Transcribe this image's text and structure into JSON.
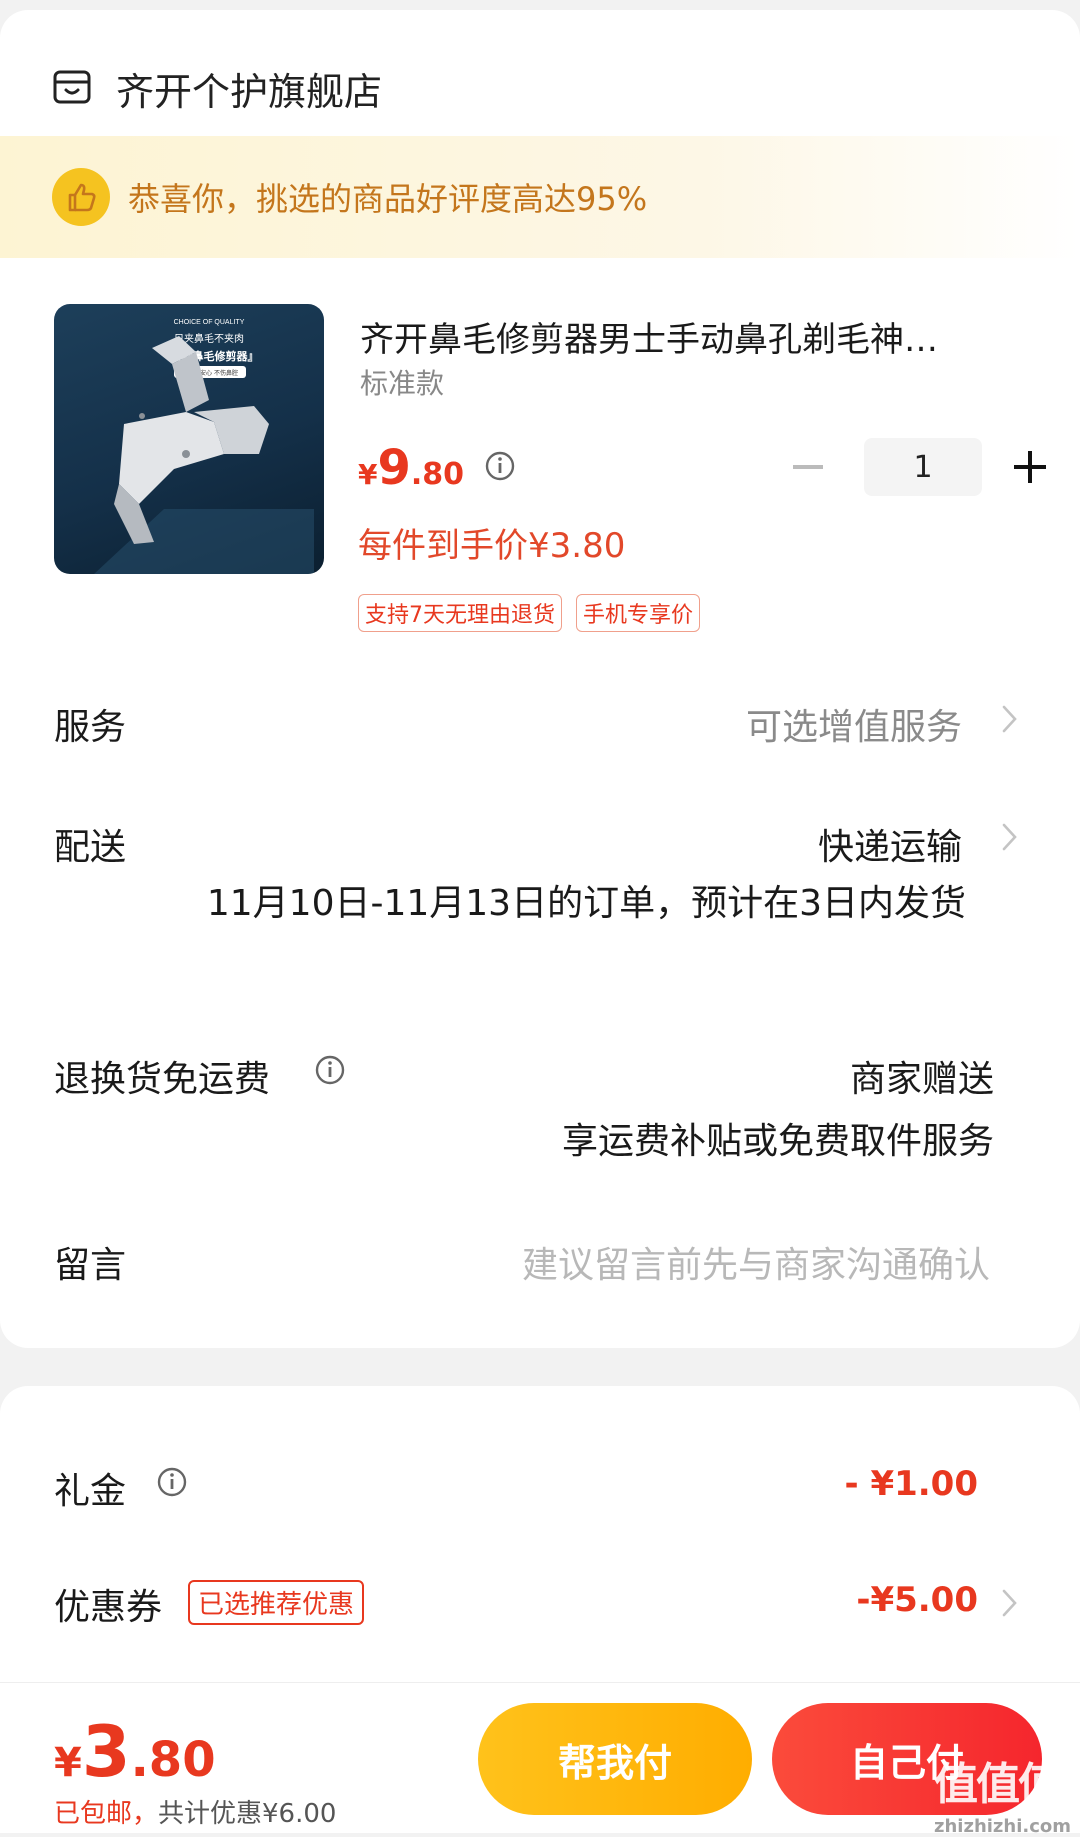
{
  "store": {
    "name": "齐开个护旗舰店",
    "icon": "store-icon"
  },
  "banner": {
    "text": "恭喜你，挑选的商品好评度高达95%",
    "icon": "thumbs-up-icon"
  },
  "product": {
    "title": "齐开鼻毛修剪器男士手动鼻孔剃毛神…",
    "variant": "标准款",
    "price_symbol": "¥",
    "price_int": "9",
    "price_dec": ".80",
    "per_price": "每件到手价¥3.80",
    "tags": [
      "支持7天无理由退货",
      "手机专享价"
    ],
    "quantity": "1",
    "image_text": {
      "line1": "CHOICE OF QUALITY",
      "line2": "只夹鼻毛不夹肉",
      "line3": "『新款鼻毛修剪器』",
      "line4": "持毛很安心  不伤鼻腔"
    }
  },
  "service": {
    "label": "服务",
    "value": "可选增值服务"
  },
  "delivery": {
    "label": "配送",
    "value": "快递运输",
    "note": "11月10日-11月13日的订单，预计在3日内发货"
  },
  "return_shipping": {
    "label": "退换货免运费",
    "value": "商家赠送",
    "sub": "享运费补贴或免费取件服务"
  },
  "message": {
    "label": "留言",
    "placeholder": "建议留言前先与商家沟通确认"
  },
  "gift": {
    "label": "礼金",
    "value": "- ¥1.00"
  },
  "coupon": {
    "label": "优惠券",
    "tag": "已选推荐优惠",
    "value": "-¥5.00"
  },
  "footer": {
    "total_symbol": "¥",
    "total_int": "3",
    "total_dec": ".80",
    "free_shipping": "已包邮，",
    "saving": "共计优惠¥6.00",
    "help_pay": "帮我付",
    "self_pay": "自己付"
  },
  "watermark": {
    "text": "值值值",
    "site": "zhizhizhi.com"
  },
  "colors": {
    "accent_red": "#e8381f",
    "gold": "#ffb400",
    "banner_text": "#c4761c"
  }
}
